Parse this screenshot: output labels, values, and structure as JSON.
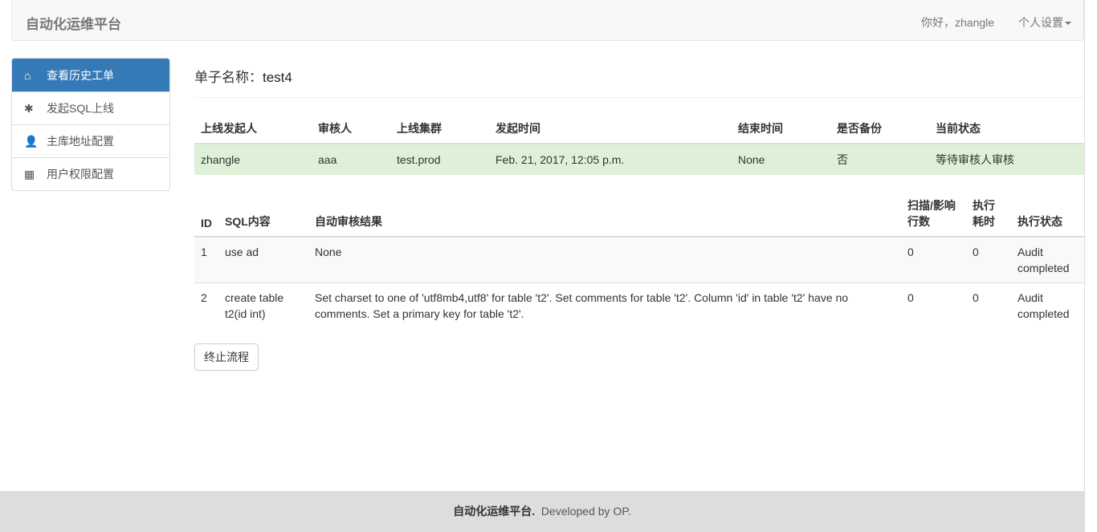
{
  "navbar": {
    "brand": "自动化运维平台",
    "greeting": "你好，zhangle",
    "settings": "个人设置"
  },
  "sidebar": {
    "items": [
      {
        "label": "查看历史工单",
        "icon": "home-icon"
      },
      {
        "label": "发起SQL上线",
        "icon": "asterisk-icon"
      },
      {
        "label": "主库地址配置",
        "icon": "user-icon"
      },
      {
        "label": "用户权限配置",
        "icon": "grid-icon"
      }
    ]
  },
  "main": {
    "title_label": "单子名称：",
    "title_value": "test4",
    "order_table": {
      "headers": [
        "上线发起人",
        "审核人",
        "上线集群",
        "发起时间",
        "结束时间",
        "是否备份",
        "当前状态"
      ],
      "row": [
        "zhangle",
        "aaa",
        "test.prod",
        "Feb. 21, 2017, 12:05 p.m.",
        "None",
        "否",
        "等待审核人审核"
      ]
    },
    "sql_table": {
      "headers": [
        "ID",
        "SQL内容",
        "自动审核结果",
        "扫描/影响行数",
        "执行耗时",
        "执行状态"
      ],
      "rows": [
        [
          "1",
          "use ad",
          "None",
          "0",
          "0",
          "Audit completed"
        ],
        [
          "2",
          "create table t2(id int)",
          "Set charset to one of 'utf8mb4,utf8' for table 't2'. Set comments for table 't2'. Column 'id' in table 't2' have no comments. Set a primary key for table 't2'.",
          "0",
          "0",
          "Audit completed"
        ]
      ]
    },
    "stop_button": "终止流程"
  },
  "footer": {
    "brand": "自动化运维平台.",
    "text": "Developed by OP."
  }
}
